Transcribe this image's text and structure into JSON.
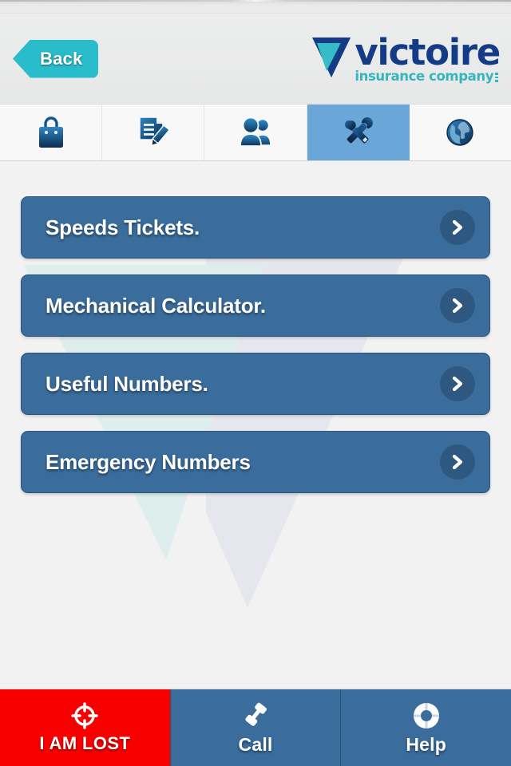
{
  "colors": {
    "page_background": "#f2f2f2",
    "header_background": "#eceded",
    "back_button": "#29bcca",
    "brand_blue": "#143c86",
    "brand_teal": "#34b6bd",
    "menu_button": "#3a6d9c",
    "menu_button_border": "#2b5479",
    "chevron_circle": "#2f5880",
    "tab_active": "#6ba6d8",
    "tab_inactive": "#f8f8f8",
    "alert_red": "#f90000",
    "bottom_bar": "#3a6d9c",
    "text_white": "#ffffff"
  },
  "header": {
    "back_button_label": "Back",
    "logo": {
      "mark_icon": "victoire-triangle-logo-icon",
      "name": "victoire",
      "tagline": "insurance company"
    }
  },
  "tabs": [
    {
      "name": "shopping-bag",
      "icon": "shopping-bag-icon",
      "active": false
    },
    {
      "name": "documents",
      "icon": "document-pencil-icon",
      "active": false
    },
    {
      "name": "contacts",
      "icon": "people-icon",
      "active": false
    },
    {
      "name": "tools",
      "icon": "tools-icon",
      "active": true
    },
    {
      "name": "world",
      "icon": "globe-icon",
      "active": false
    }
  ],
  "menu": {
    "items": [
      {
        "label": "Speeds Tickets.",
        "chevron_icon": "chevron-right-icon"
      },
      {
        "label": "Mechanical Calculator.",
        "chevron_icon": "chevron-right-icon"
      },
      {
        "label": "Useful Numbers.",
        "chevron_icon": "chevron-right-icon"
      },
      {
        "label": "Emergency Numbers",
        "chevron_icon": "chevron-right-icon"
      }
    ]
  },
  "bottom_bar": {
    "buttons": [
      {
        "label": "I AM LOST",
        "icon": "crosshair-target-icon",
        "style": "alert"
      },
      {
        "label": "Call",
        "icon": "phone-handset-icon",
        "style": "normal"
      },
      {
        "label": "Help",
        "icon": "lifebuoy-icon",
        "style": "normal"
      }
    ]
  },
  "watermark": {
    "description": "faded victoire triangle logo",
    "teal_color": "#dff0ee",
    "grey_color": "#e6e6ee"
  }
}
